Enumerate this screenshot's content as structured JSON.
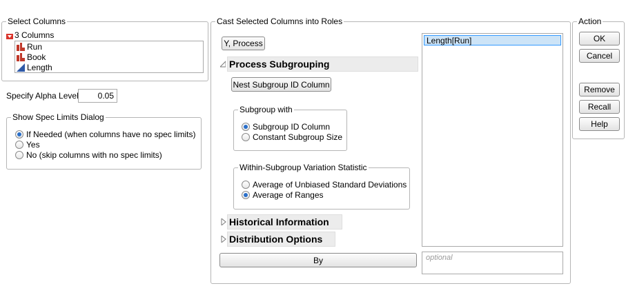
{
  "select_columns": {
    "title": "Select Columns",
    "count_label": "3 Columns",
    "columns": [
      {
        "name": "Run",
        "type": "nominal"
      },
      {
        "name": "Book",
        "type": "nominal"
      },
      {
        "name": "Length",
        "type": "continuous"
      }
    ]
  },
  "alpha": {
    "label": "Specify Alpha Level",
    "value": "0.05"
  },
  "spec_limits": {
    "title": "Show Spec Limits Dialog",
    "options": [
      {
        "label": "If Needed (when columns have no spec limits)",
        "selected": true
      },
      {
        "label": "Yes",
        "selected": false
      },
      {
        "label": "No (skip columns with no spec limits)",
        "selected": false
      }
    ]
  },
  "cast": {
    "title": "Cast Selected Columns into Roles",
    "y_button": "Y, Process",
    "y_list": [
      "Length[Run]"
    ],
    "process_subgrouping": "Process Subgrouping",
    "nest_button": "Nest Subgroup ID Column",
    "subgroup_with": {
      "title": "Subgroup with",
      "options": [
        {
          "label": "Subgroup ID Column",
          "selected": true
        },
        {
          "label": "Constant Subgroup Size",
          "selected": false
        }
      ]
    },
    "within_stat": {
      "title": "Within-Subgroup Variation Statistic",
      "options": [
        {
          "label": "Average of Unbiased Standard Deviations",
          "selected": false
        },
        {
          "label": "Average of Ranges",
          "selected": true
        }
      ]
    },
    "historical": "Historical Information",
    "distribution": "Distribution Options",
    "by_button": "By",
    "by_placeholder": "optional"
  },
  "action": {
    "title": "Action",
    "ok": "OK",
    "cancel": "Cancel",
    "remove": "Remove",
    "recall": "Recall",
    "help": "Help"
  },
  "colors": {
    "selection": "#cde4f7",
    "selection_border": "#3399ff",
    "radio_dot": "#2a6fc9",
    "nominal_icon": "#c0392b",
    "continuous_icon": "#2f5aa8"
  }
}
